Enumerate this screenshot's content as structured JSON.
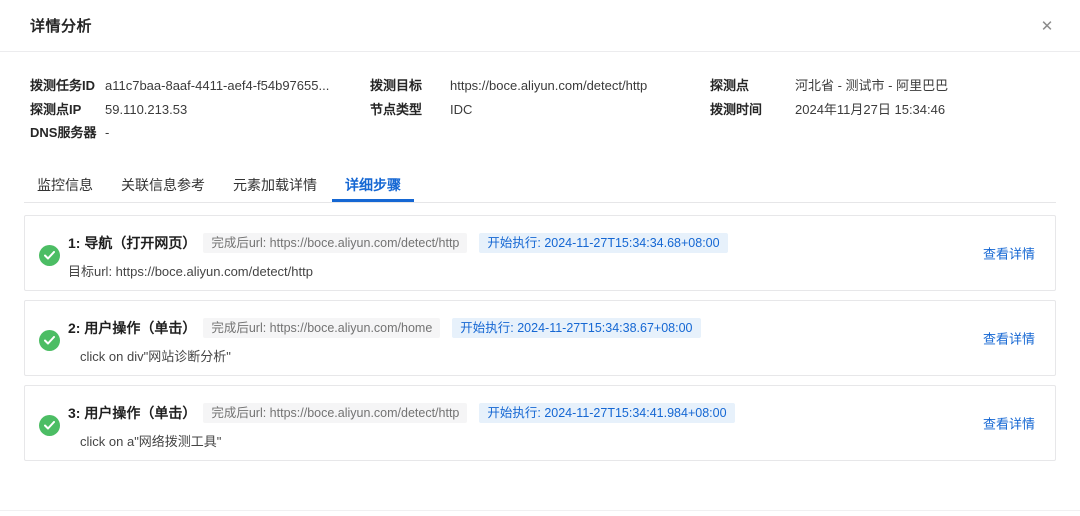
{
  "colors": {
    "accent_blue": "#1567d3",
    "success_green": "#4cbd64",
    "badge_blue_bg": "#e7f1fb",
    "badge_gray_bg": "#f5f5f6"
  },
  "modal": {
    "title": "详情分析",
    "close_glyph": "✕"
  },
  "info": {
    "columns": [
      {
        "rows": [
          {
            "label": "拨测任务ID",
            "value": "a11c7baa-8aaf-4411-aef4-f54b97655..."
          },
          {
            "label": "探测点IP",
            "value": "59.110.213.53"
          },
          {
            "label": "DNS服务器",
            "value": "-"
          }
        ]
      },
      {
        "rows": [
          {
            "label": "拨测目标",
            "value": "https://boce.aliyun.com/detect/http"
          },
          {
            "label": "节点类型",
            "value": "IDC"
          }
        ]
      },
      {
        "rows": [
          {
            "label": "探测点",
            "value": "河北省 - 测试市 - 阿里巴巴"
          },
          {
            "label": "拨测时间",
            "value": "2024年11月27日 15:34:46"
          }
        ]
      }
    ]
  },
  "tabs": [
    {
      "label": "监控信息",
      "active": false
    },
    {
      "label": "关联信息参考",
      "active": false
    },
    {
      "label": "元素加载详情",
      "active": false
    },
    {
      "label": "详细步骤",
      "active": true
    }
  ],
  "steps": [
    {
      "title": "1: 导航（打开网页）",
      "finish_url_badge": "完成后url: https://boce.aliyun.com/detect/http",
      "start_time_badge": "开始执行: 2024-11-27T15:34:34.68+08:00",
      "detail": "目标url: https://boce.aliyun.com/detect/http",
      "view_detail_label": "查看详情"
    },
    {
      "title": "2: 用户操作（单击）",
      "finish_url_badge": "完成后url: https://boce.aliyun.com/home",
      "start_time_badge": "开始执行: 2024-11-27T15:34:38.67+08:00",
      "detail": "click on div\"网站诊断分析\"",
      "view_detail_label": "查看详情"
    },
    {
      "title": "3: 用户操作（单击）",
      "finish_url_badge": "完成后url: https://boce.aliyun.com/detect/http",
      "start_time_badge": "开始执行: 2024-11-27T15:34:41.984+08:00",
      "detail": "click on a\"网络拨测工具\"",
      "view_detail_label": "查看详情"
    }
  ]
}
